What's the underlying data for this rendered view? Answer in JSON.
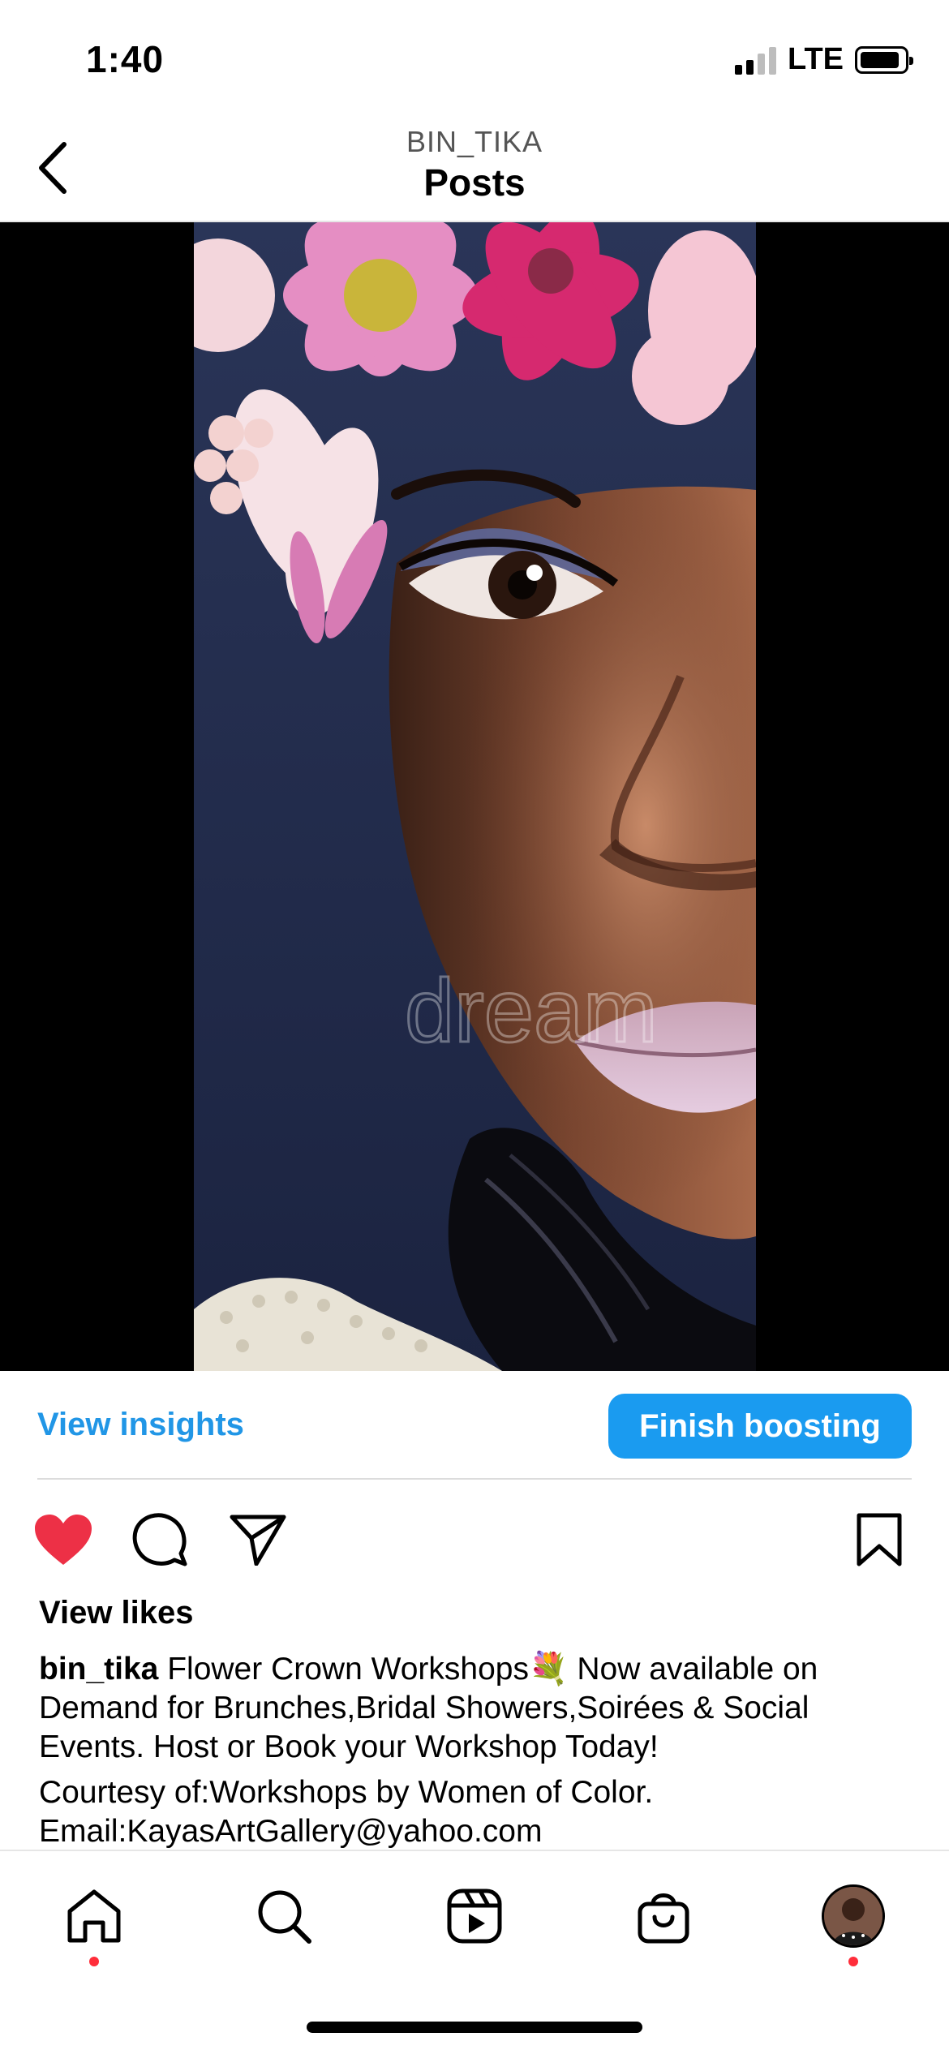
{
  "status_bar": {
    "time": "1:40",
    "network": "LTE"
  },
  "header": {
    "account": "BIN_TIKA",
    "title": "Posts"
  },
  "post": {
    "watermark": "dream",
    "view_insights": "View insights",
    "boost_label": "Finish boosting",
    "view_likes": "View likes",
    "username": "bin_tika",
    "caption_text": "Flower Crown Workshops💐 Now available on Demand for Brunches,Bridal Showers,Soirées & Social Events. Host or Book your Workshop Today!",
    "caption_line2": "Courtesy of:Workshops by Women of Color.",
    "caption_line3": "Email:KayasArtGallery@yahoo.com",
    "liked": true
  },
  "colors": {
    "accent": "#1a9bf0",
    "link": "#2196e6",
    "like": "#ed3046",
    "notification_dot": "#ff2d3a"
  },
  "tab_bar": {
    "items": [
      {
        "name": "home",
        "icon": "home-icon",
        "active": true,
        "notification": true
      },
      {
        "name": "search",
        "icon": "search-icon"
      },
      {
        "name": "reels",
        "icon": "reels-icon"
      },
      {
        "name": "shop",
        "icon": "shop-bag-icon"
      },
      {
        "name": "profile",
        "icon": "profile-avatar",
        "notification": true
      }
    ]
  }
}
